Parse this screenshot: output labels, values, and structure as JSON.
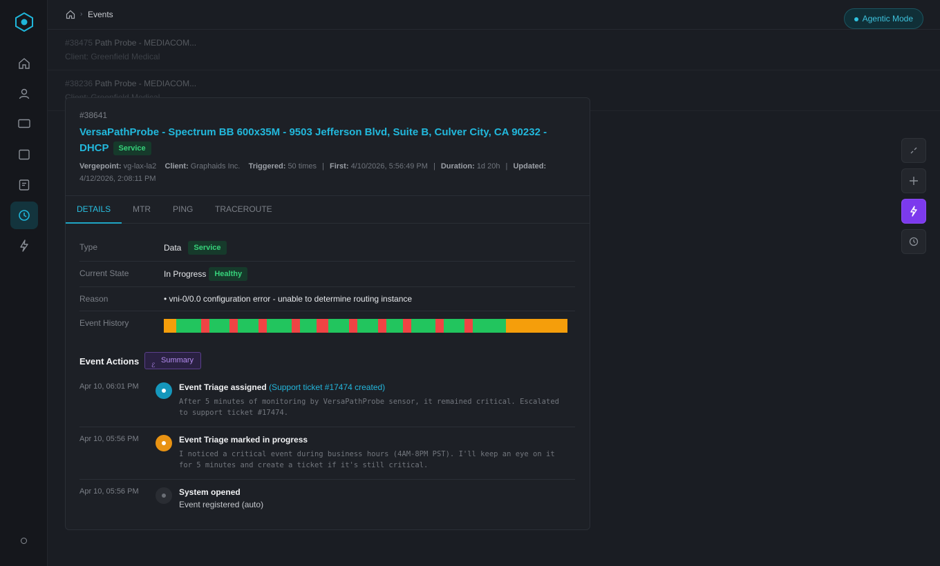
{
  "breadcrumb": {
    "current": "Events"
  },
  "agentic": {
    "label": "Agentic Mode"
  },
  "background_list": [
    {
      "id": "#38475",
      "title": "Path Probe - MEDIACOM...",
      "client": "Client: Greenfield Medical"
    },
    {
      "id": "#38236",
      "title": "Path Probe - MEDIACOM...",
      "client": "Client: Greenfield Medical"
    }
  ],
  "event": {
    "id": "#38641",
    "title": "VersaPathProbe - Spectrum BB 600x35M - 9503 Jefferson Blvd, Suite B, Culver City, CA 90232 - DHCP",
    "badge": "Service",
    "meta": {
      "vergepoint_label": "Vergepoint:",
      "vergepoint": "vg-lax-la2",
      "client_label": "Client:",
      "client": "Graphaids Inc.",
      "triggered_label": "Triggered:",
      "triggered": "50 times",
      "first_label": "First:",
      "first": "4/10/2026, 5:56:49 PM",
      "duration_label": "Duration:",
      "duration": "1d 20h",
      "updated_label": "Updated:",
      "updated": "4/12/2026, 2:08:11 PM",
      "separator": "|"
    }
  },
  "tabs": [
    {
      "label": "DETAILS",
      "active": true
    },
    {
      "label": "MTR"
    },
    {
      "label": "PING"
    },
    {
      "label": "TRACEROUTE"
    }
  ],
  "details": {
    "type_label": "Type",
    "type_value": "Data",
    "type_badge": "Service",
    "state_label": "Current State",
    "state_value": "In Progress",
    "state_badge": "Healthy",
    "reason_label": "Reason",
    "reason_value": "• vni-0/0.0 configuration error - unable to determine routing instance",
    "history_label": "Event History"
  },
  "event_history": {
    "colors": {
      "g": "#22c55e",
      "r": "#ef4444",
      "o": "#f59e0b"
    },
    "segments": [
      [
        "o",
        3
      ],
      [
        "g",
        6
      ],
      [
        "r",
        2
      ],
      [
        "g",
        5
      ],
      [
        "r",
        2
      ],
      [
        "g",
        5
      ],
      [
        "r",
        2
      ],
      [
        "g",
        6
      ],
      [
        "r",
        2
      ],
      [
        "g",
        4
      ],
      [
        "r",
        3
      ],
      [
        "g",
        5
      ],
      [
        "r",
        2
      ],
      [
        "g",
        5
      ],
      [
        "r",
        2
      ],
      [
        "g",
        4
      ],
      [
        "r",
        2
      ],
      [
        "g",
        6
      ],
      [
        "r",
        2
      ],
      [
        "g",
        5
      ],
      [
        "r",
        2
      ],
      [
        "g",
        8
      ],
      [
        "o",
        15
      ]
    ]
  },
  "actions": {
    "title": "Event Actions",
    "summary_label": "Summary",
    "items": [
      {
        "time": "Apr 10, 06:01 PM",
        "title": "Event Triage assigned",
        "link": "(Support ticket #17474 created)",
        "body": "After 5 minutes of monitoring by VersaPathProbe sensor, it remained critical. Escalated to support ticket #17474."
      },
      {
        "time": "Apr 10, 05:56 PM",
        "title": "Event Triage marked in progress",
        "body": "I noticed a critical event during business hours (4AM-8PM PST). I'll keep an eye on it for 5 minutes and create a ticket if it's still critical."
      },
      {
        "time": "Apr 10, 05:56 PM",
        "title": "System opened",
        "body": "Event registered (auto)"
      }
    ]
  }
}
